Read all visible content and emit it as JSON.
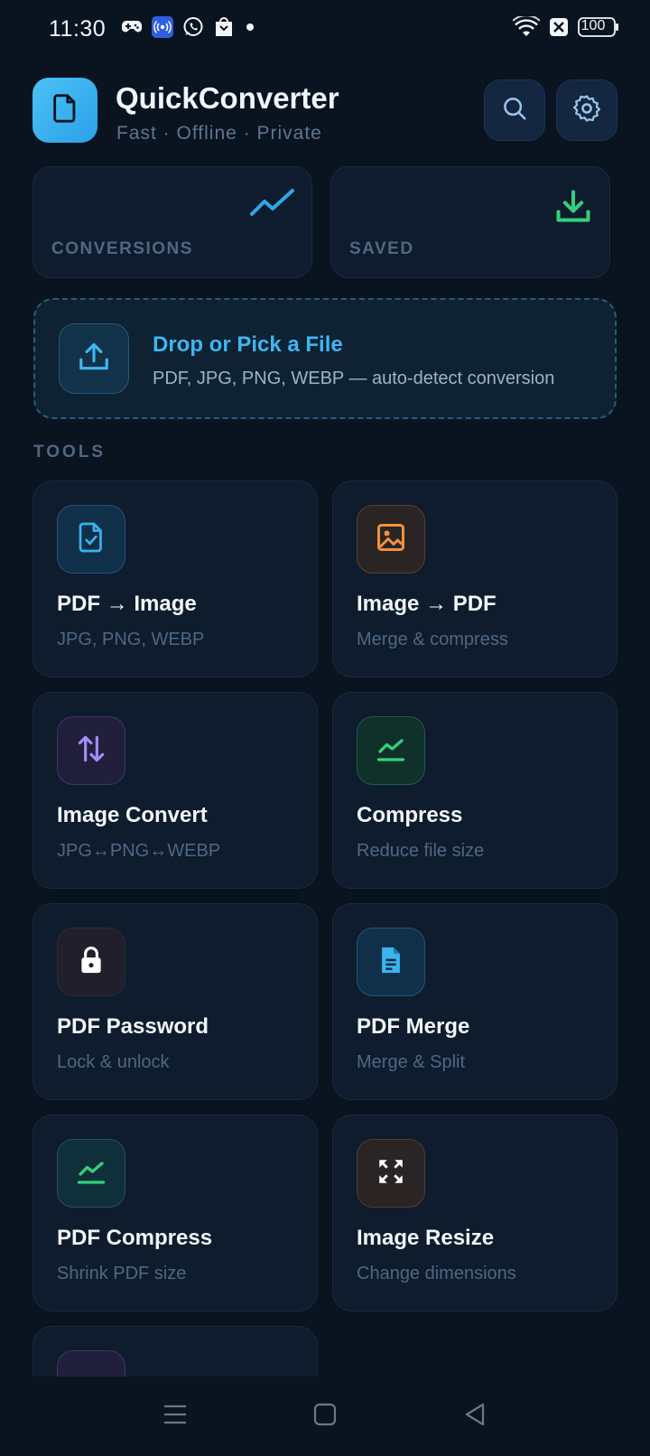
{
  "status_bar": {
    "time": "11:30",
    "battery": "100"
  },
  "app": {
    "title": "QuickConverter",
    "subtitle": "Fast · Offline · Private"
  },
  "stats": [
    {
      "label": "CONVERSIONS",
      "icon": "trend-up-icon",
      "color": "#2fa8e8"
    },
    {
      "label": "SAVED",
      "icon": "download-icon",
      "color": "#34d17c"
    }
  ],
  "drop_zone": {
    "title": "Drop or Pick a File",
    "subtitle": "PDF, JPG, PNG, WEBP — auto-detect conversion"
  },
  "tools_section_label": "TOOLS",
  "tools": [
    {
      "title": "PDF → Image",
      "subtitle": "JPG, PNG, WEBP",
      "icon": "file-check-icon",
      "color": "#3ab3ef"
    },
    {
      "title": "Image → PDF",
      "subtitle": "Merge & compress",
      "icon": "image-icon",
      "color": "#f3913b"
    },
    {
      "title": "Image Convert",
      "subtitle": "JPG↔PNG↔WEBP",
      "icon": "swap-vertical-icon",
      "color": "#a58cf6"
    },
    {
      "title": "Compress",
      "subtitle": "Reduce file size",
      "icon": "chart-line-icon",
      "color": "#34d17c"
    },
    {
      "title": "PDF Password",
      "subtitle": "Lock & unlock",
      "icon": "lock-icon",
      "color": "#ffffff"
    },
    {
      "title": "PDF Merge",
      "subtitle": "Merge & Split",
      "icon": "document-icon",
      "color": "#3ab3ef"
    },
    {
      "title": "PDF Compress",
      "subtitle": "Shrink PDF size",
      "icon": "chart-line-icon",
      "color": "#34d17c"
    },
    {
      "title": "Image Resize",
      "subtitle": "Change dimensions",
      "icon": "expand-icon",
      "color": "#ffffff"
    },
    {
      "title": "",
      "subtitle": "",
      "icon": "partial-icon",
      "color": "#a58cf6"
    }
  ]
}
